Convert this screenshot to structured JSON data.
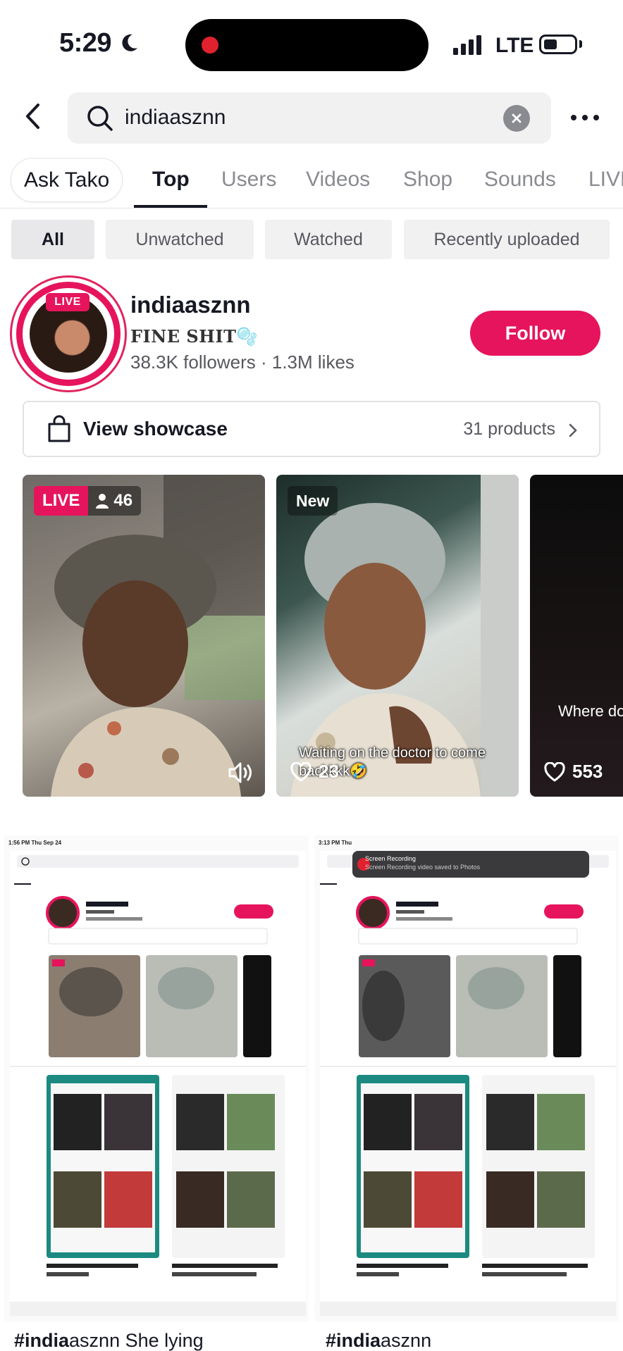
{
  "status_bar": {
    "time": "5:29",
    "network": "LTE"
  },
  "search": {
    "query": "indiaasznn"
  },
  "tabs": {
    "ask": "Ask Tako",
    "items": [
      "Top",
      "Users",
      "Videos",
      "Shop",
      "Sounds",
      "LIVE"
    ]
  },
  "filters": [
    "All",
    "Unwatched",
    "Watched",
    "Recently uploaded"
  ],
  "user": {
    "live_tag": "LIVE",
    "username": "indiaasznn",
    "display_name": "FINE SHIT🫧",
    "stats": "38.3K followers · 1.3M likes",
    "follow": "Follow"
  },
  "showcase": {
    "label": "View showcase",
    "products": "31 products"
  },
  "videos": [
    {
      "badge": "LIVE",
      "viewers": "46"
    },
    {
      "badge": "New",
      "caption": "Waiting on the doctor to come backkkk🤣",
      "likes": "23"
    },
    {
      "caption": "Where do",
      "likes": "553"
    }
  ],
  "results": [
    {
      "mini_time": "1:56 PM  Thu Sep 24",
      "mini_query": "fineshit.india",
      "mini_live_viewers": "30",
      "mini_likes": "550",
      "caption_tag": "#india",
      "caption_rest": "asznn She lying"
    },
    {
      "mini_time": "3:13 PM  Thu",
      "mini_query": "f",
      "mini_live_viewers": "11",
      "mini_likes": "553",
      "banner_title": "Screen Recording",
      "banner_sub": "Screen Recording video saved to Photos",
      "caption_tag": "#india",
      "caption_rest": "asznn"
    }
  ],
  "colors": {
    "brand": "#e6145c",
    "text": "#161823",
    "muted": "#8a8b91"
  }
}
